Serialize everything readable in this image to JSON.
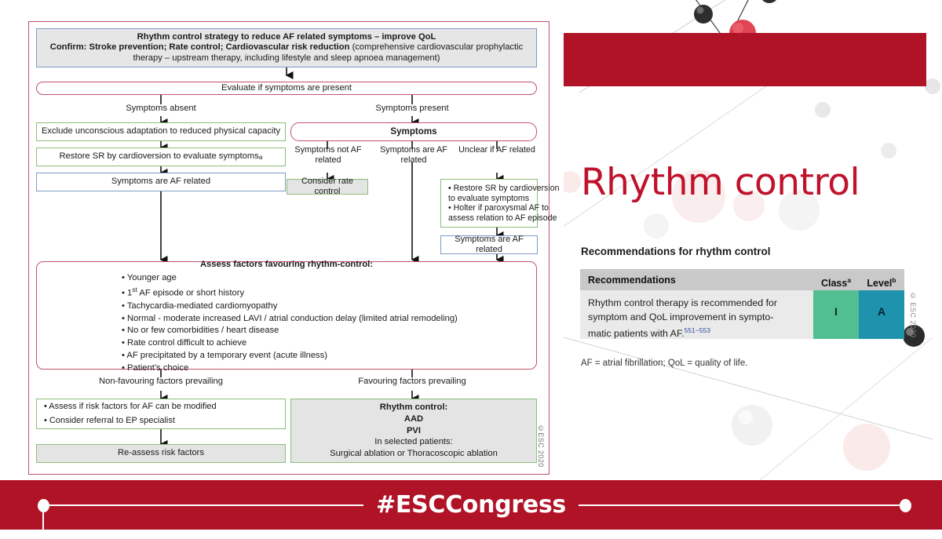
{
  "flowchart": {
    "header": {
      "line1": "Rhythm control strategy to reduce AF related symptoms – improve QoL",
      "line2_bold": "Confirm: Stroke prevention; Rate control; Cardiovascular risk reduction",
      "line2_rest": " (comprehensive cardiovascular prophylactic",
      "line3": "therapy – upstream therapy, including lifestyle and sleep apnoea management)"
    },
    "evaluate": "Evaluate if symptoms are present",
    "branch_absent": "Symptoms absent",
    "branch_present": "Symptoms present",
    "exclude": "Exclude unconscious adaptation to reduced physical capacity",
    "restore_left": "Restore SR by cardioversion to evaluate symptoms",
    "restore_left_sup": "a",
    "af_related_left": "Symptoms are AF related",
    "symptoms": "Symptoms",
    "sub_not_af": "Symptoms not AF related",
    "sub_are_af": "Symptoms  are  AF related",
    "sub_unclear": "Unclear if AF related",
    "consider_rate_control": "Consider rate control",
    "unclear_bullets": [
      "• Restore SR by cardioversion",
      "   to evaluate symptoms",
      "• Holter if paroxysmal AF to",
      "   assess relation to AF episode"
    ],
    "af_related_right": "Symptoms are AF related",
    "assess_title": "Assess factors favouring rhythm-control:",
    "assess_bullets": [
      "• Younger age",
      "• 1st AF episode or short history",
      "• Tachycardia-mediated cardiomyopathy",
      "• Normal - moderate increased LAVI / atrial conduction delay (limited atrial remodeling)",
      "• No or few comorbidities / heart disease",
      "• Rate control difficult to achieve",
      "• AF precipitated by a temporary event (acute illness)",
      "• Patient’s choice"
    ],
    "non_favouring": "Non-favouring factors prevailing",
    "favouring": "Favouring factors prevailing",
    "nonfav_bullets": [
      "• Assess if risk factors for AF can be modified",
      "• Consider referral to EP specialist"
    ],
    "reassess": "Re-assess risk factors",
    "rhythm_control_box": {
      "title": "Rhythm control:",
      "aad": "AAD",
      "pvi": "PVI",
      "selected": "In selected patients:",
      "surgical": "Surgical ablation or Thoracoscopic ablation"
    },
    "copyright": "©ESC 2020"
  },
  "right": {
    "title": "Rhythm control",
    "rec_heading": "Recommendations for rhythm control",
    "table": {
      "headers": [
        "Recommendations",
        "Class",
        "Level"
      ],
      "header_sups": [
        "",
        "a",
        "b"
      ],
      "row": {
        "text_l1": "Rhythm control therapy is recommended for",
        "text_l2": "symptom and QoL improvement in sympto-",
        "text_l3": "matic patients with AF.",
        "reference": "551−553",
        "class": "I",
        "level": "A"
      }
    },
    "footnote": "AF = atrial fibrillation; QoL = quality of life.",
    "copyright": "© ESC 2020"
  },
  "banner": {
    "hashtag": "#ESCCongress"
  },
  "colors": {
    "brand_red": "#b01226",
    "title_red": "#c0122c",
    "class_green": "#52bf90",
    "level_teal": "#1f93ae",
    "header_grey": "#c9c9c9"
  }
}
